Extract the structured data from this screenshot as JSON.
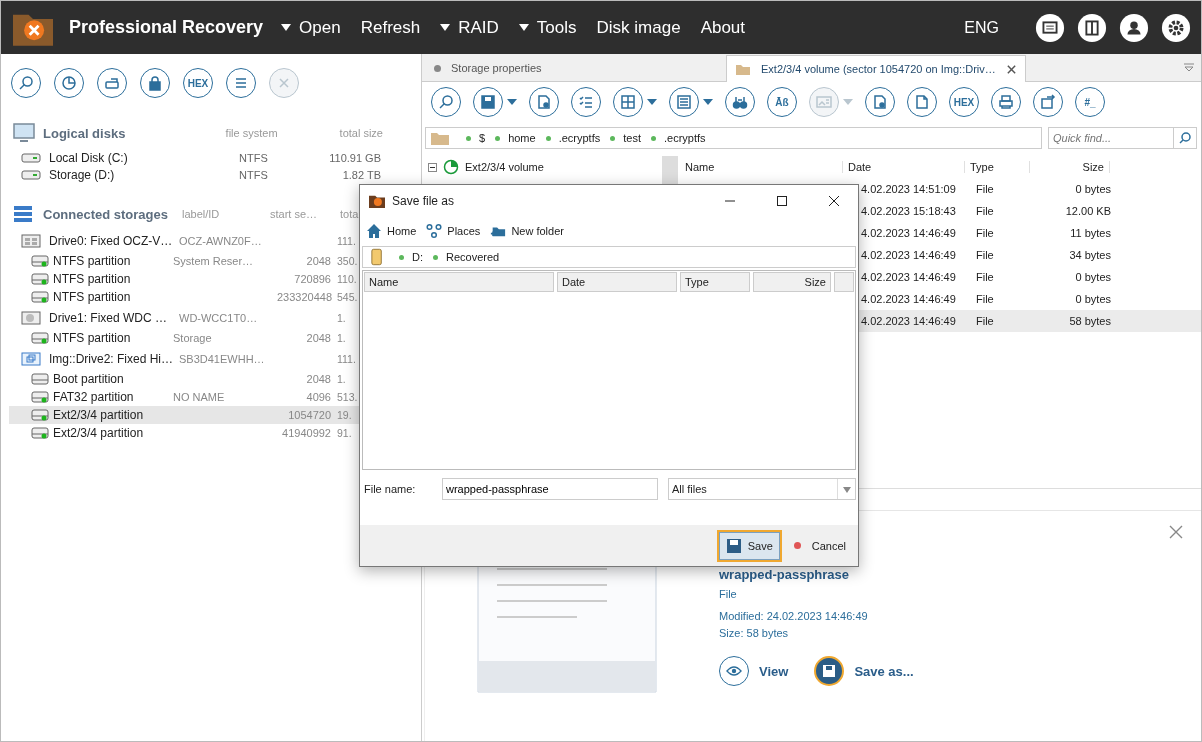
{
  "app": {
    "title": "Professional Recovery",
    "language": "ENG",
    "menu": [
      {
        "label": "Open",
        "dropdown": true
      },
      {
        "label": "Refresh",
        "dropdown": false
      },
      {
        "label": "RAID",
        "dropdown": true
      },
      {
        "label": "Tools",
        "dropdown": true
      },
      {
        "label": "Disk image",
        "dropdown": false
      },
      {
        "label": "About",
        "dropdown": false
      }
    ]
  },
  "left_toolbar": [
    {
      "disabled": false
    },
    {
      "disabled": false
    },
    {
      "disabled": false
    },
    {
      "disabled": false
    },
    {
      "text": "HEX",
      "disabled": false
    },
    {
      "disabled": false
    },
    {
      "disabled": true
    }
  ],
  "logical_disks": {
    "title": "Logical disks",
    "columns": [
      "file system",
      "total size"
    ],
    "rows": [
      {
        "name": "Local Disk (C:)",
        "fs": "NTFS",
        "size": "110.91 GB"
      },
      {
        "name": "Storage (D:)",
        "fs": "NTFS",
        "size": "1.82 TB"
      }
    ]
  },
  "connected_storages": {
    "title": "Connected storages",
    "columns": [
      "label/ID",
      "start se…",
      "tota"
    ],
    "items": [
      {
        "kind": "ssd",
        "name": "Drive0: Fixed OCZ-V…",
        "label": "OCZ-AWNZ0F…",
        "size": "111.",
        "children": [
          {
            "name": "NTFS partition",
            "label": "System Reser…",
            "start": "2048",
            "size": "350.",
            "mounted": true,
            "selected": false
          },
          {
            "name": "NTFS partition",
            "start": "720896",
            "size": "110.",
            "mounted": true,
            "selected": false
          },
          {
            "name": "NTFS partition",
            "start": "233320448",
            "size": "545.",
            "mounted": true,
            "selected": false
          }
        ]
      },
      {
        "kind": "hdd",
        "name": "Drive1: Fixed WDC …",
        "label": "WD-WCC1T0…",
        "size": "1.",
        "children": [
          {
            "name": "NTFS partition",
            "label": "Storage",
            "start": "2048",
            "size": "1.",
            "mounted": true,
            "selected": false
          }
        ]
      },
      {
        "kind": "image",
        "name": "Img::Drive2: Fixed Hi…",
        "label": "SB3D41EWHH…",
        "size": "111.",
        "children": [
          {
            "name": "Boot partition",
            "start": "2048",
            "size": "1.",
            "mounted": false,
            "selected": false
          },
          {
            "name": "FAT32 partition",
            "label": "NO NAME",
            "start": "4096",
            "size": "513.",
            "mounted": true,
            "selected": false
          },
          {
            "name": "Ext2/3/4 partition",
            "start": "1054720",
            "size": "19.",
            "mounted": true,
            "selected": true
          },
          {
            "name": "Ext2/3/4 partition",
            "start": "41940992",
            "size": "91.",
            "mounted": true,
            "selected": false
          }
        ]
      }
    ]
  },
  "tabs": [
    {
      "label": "Storage properties",
      "selected": false
    },
    {
      "label": "Ext2/3/4 volume (sector 1054720 on Img::Driv…",
      "selected": true
    }
  ],
  "toolbar": [
    {
      "dropdown": false,
      "disabled": false
    },
    {
      "dropdown": true,
      "disabled": false
    },
    {
      "dropdown": false,
      "disabled": false
    },
    {
      "dropdown": false,
      "disabled": false
    },
    {
      "dropdown": true,
      "disabled": false
    },
    {
      "dropdown": true,
      "disabled": false
    },
    {
      "dropdown": false,
      "disabled": false
    },
    {
      "text": "Āß",
      "dropdown": false,
      "disabled": false
    },
    {
      "dropdown": true,
      "disabled": true
    },
    {
      "dropdown": false,
      "disabled": false
    },
    {
      "dropdown": false,
      "disabled": false
    },
    {
      "text": "HEX",
      "dropdown": false,
      "disabled": false
    },
    {
      "dropdown": false,
      "disabled": false
    },
    {
      "dropdown": false,
      "disabled": false
    },
    {
      "text": "#_",
      "dropdown": false,
      "disabled": false
    }
  ],
  "path": [
    "$",
    "home",
    ".ecryptfs",
    "test",
    ".ecryptfs"
  ],
  "quick_find": {
    "placeholder": "Quick find..."
  },
  "tree": [
    {
      "label": "Ext2/3/4 volume",
      "expanded": true
    }
  ],
  "file_list": {
    "columns": [
      "Name",
      "Date",
      "Type",
      "Size"
    ],
    "rows": [
      {
        "date": "4.02.2023 14:51:09",
        "type": "File",
        "size": "0 bytes",
        "selected": false
      },
      {
        "date": "4.02.2023 15:18:43",
        "type": "File",
        "size": "12.00 KB",
        "selected": false
      },
      {
        "date": "4.02.2023 14:46:49",
        "type": "File",
        "size": "11 bytes",
        "selected": false
      },
      {
        "date": "4.02.2023 14:46:49",
        "type": "File",
        "size": "34 bytes",
        "selected": false
      },
      {
        "date": "4.02.2023 14:46:49",
        "type": "File",
        "size": "0 bytes",
        "selected": false
      },
      {
        "date": "4.02.2023 14:46:49",
        "type": "File",
        "size": "0 bytes",
        "selected": false
      },
      {
        "date": "4.02.2023 14:46:49",
        "type": "File",
        "size": "58 bytes",
        "selected": true
      }
    ]
  },
  "preview": {
    "name": "wrapped-passphrase",
    "type": "File",
    "modified": "Modified: 24.02.2023 14:46:49",
    "size": "Size: 58 bytes",
    "actions": [
      {
        "kind": "view",
        "label": "View",
        "focused": false
      },
      {
        "kind": "save",
        "label": "Save as...",
        "focused": true
      }
    ]
  },
  "dialog": {
    "title": "Save file as",
    "toolbar": [
      {
        "kind": "home",
        "label": "Home"
      },
      {
        "kind": "places",
        "label": "Places"
      },
      {
        "kind": "folder",
        "label": "New folder"
      }
    ],
    "path": [
      "D:",
      "Recovered"
    ],
    "columns": [
      "Name",
      "Date",
      "Type",
      "Size"
    ],
    "file_name_label": "File name:",
    "file_name": "wrapped-passphrase",
    "filter": "All files",
    "buttons": [
      {
        "kind": "save",
        "label": "Save",
        "focused": true
      },
      {
        "kind": "cancel",
        "label": "Cancel",
        "focused": false
      }
    ]
  }
}
